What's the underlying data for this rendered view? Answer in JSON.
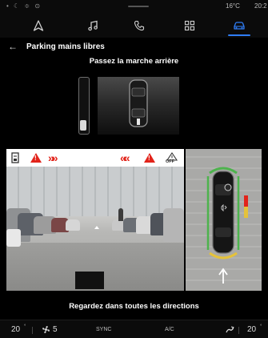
{
  "status_bar": {
    "icons": "• ☾ ≑ ⊙",
    "temperature": "16°C",
    "time": "20:2"
  },
  "nav": [
    {
      "icon": "navigation-arrow-icon"
    },
    {
      "icon": "music-note-icon"
    },
    {
      "icon": "phone-icon"
    },
    {
      "icon": "apps-grid-icon"
    },
    {
      "icon": "car-icon",
      "active": true
    }
  ],
  "header": {
    "back": "←",
    "title": "Parking mains libres"
  },
  "instruction": "Passez la marche arrière",
  "camera": {
    "left_chevrons": "»»",
    "right_chevrons": "««",
    "off_label": "OFF"
  },
  "bottom_message": "Regardez dans toutes les directions",
  "climate": {
    "left_temp": "20",
    "fan_level": "5",
    "sync": "SYNC",
    "ac": "A/C",
    "right_temp": "20"
  },
  "colors": {
    "accent": "#2f7df6",
    "warning": "#e2231a",
    "sensor_green": "#4db34d",
    "sensor_yellow": "#e5c23a"
  }
}
